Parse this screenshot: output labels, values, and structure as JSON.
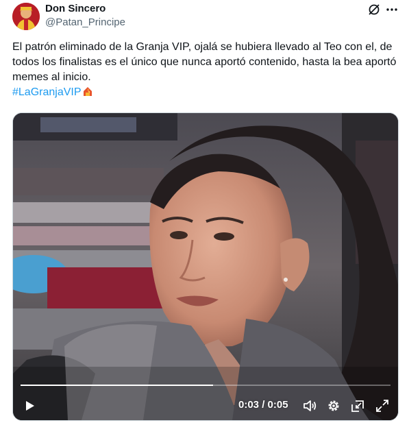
{
  "author": {
    "name": "Don Sincero",
    "handle": "@Patan_Principe"
  },
  "tweet": {
    "text_line": "El patrón eliminado de la Granja VIP, ojalá se hubiera llevado al Teo con el, de todos los finalistas es el único que nunca aportó contenido, hasta la bea aportó memes al inicio.",
    "hashtag": "#LaGranjaVIP"
  },
  "video": {
    "current_time": "0:03",
    "separator": "/",
    "duration": "0:05",
    "progress": 0.52
  },
  "icons": {
    "grok": "grok-icon",
    "more": "more-icon",
    "play": "play-icon",
    "volume": "volume-icon",
    "settings": "gear-icon",
    "pip": "picture-in-picture-icon",
    "fullscreen": "fullscreen-icon",
    "house_emoji": "house-fire-emoji"
  },
  "colors": {
    "hashtag": "#1d9bf0",
    "secondary_text": "#536471"
  }
}
